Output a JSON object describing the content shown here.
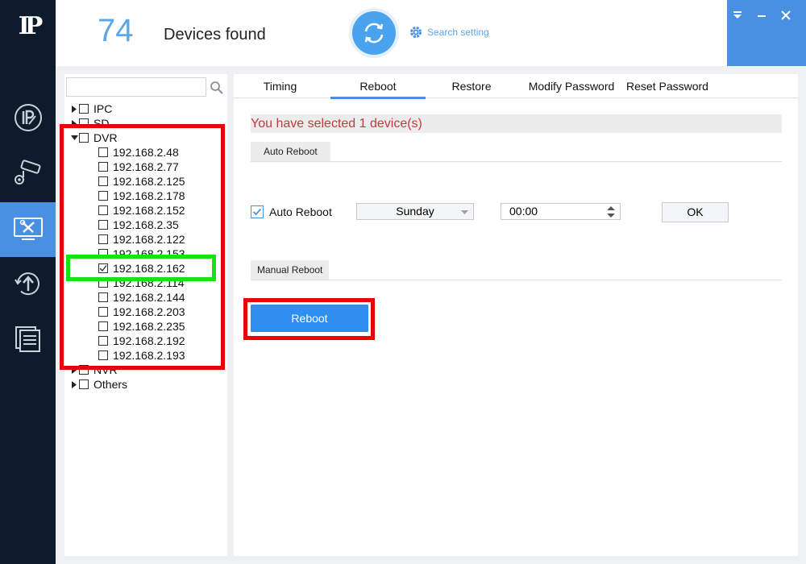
{
  "header": {
    "device_count": "74",
    "devices_found_label": "Devices found",
    "search_setting_label": "Search setting"
  },
  "sidebar": {
    "logo_text": "IP",
    "items": [
      {
        "icon": "ip-icon"
      },
      {
        "icon": "camera-settings-icon"
      },
      {
        "icon": "tools-icon",
        "active": true
      },
      {
        "icon": "upgrade-icon"
      },
      {
        "icon": "document-icon"
      }
    ]
  },
  "tree": {
    "search_value": "",
    "groups_top": [
      {
        "label": "IPC",
        "checked": false
      },
      {
        "label": "SD",
        "checked": false
      },
      {
        "label": "DVR",
        "checked": false
      }
    ],
    "dvr_items": [
      {
        "label": "192.168.2.48",
        "checked": false
      },
      {
        "label": "192.168.2.77",
        "checked": false
      },
      {
        "label": "192.168.2.125",
        "checked": false
      },
      {
        "label": "192.168.2.178",
        "checked": false
      },
      {
        "label": "192.168.2.152",
        "checked": false
      },
      {
        "label": "192.168.2.35",
        "checked": false
      },
      {
        "label": "192.168.2.122",
        "checked": false
      },
      {
        "label": "192.168.2.153",
        "checked": false
      },
      {
        "label": "192.168.2.162",
        "checked": true
      },
      {
        "label": "192.168.2.114",
        "checked": false
      },
      {
        "label": "192.168.2.144",
        "checked": false
      },
      {
        "label": "192.168.2.203",
        "checked": false
      },
      {
        "label": "192.168.2.235",
        "checked": false
      },
      {
        "label": "192.168.2.192",
        "checked": false
      },
      {
        "label": "192.168.2.193",
        "checked": false
      }
    ],
    "groups_bottom": [
      {
        "label": "NVR",
        "checked": false
      },
      {
        "label": "Others",
        "checked": false
      }
    ]
  },
  "tabs": [
    {
      "label": "Timing",
      "active": false
    },
    {
      "label": "Reboot",
      "active": true
    },
    {
      "label": "Restore",
      "active": false
    },
    {
      "label": "Modify Password",
      "active": false
    },
    {
      "label": "Reset Password",
      "active": false
    }
  ],
  "reboot": {
    "selected_message": "You have selected 1 device(s)",
    "auto_section_title": "Auto Reboot",
    "auto_reboot_label": "Auto Reboot",
    "auto_reboot_checked": true,
    "day_value": "Sunday",
    "time_value": "00:00",
    "ok_label": "OK",
    "manual_section_title": "Manual Reboot",
    "reboot_button_label": "Reboot"
  },
  "colors": {
    "accent": "#4a90e2",
    "sidebar_bg": "#0d1b2b",
    "annotation_red": "#ea0000",
    "annotation_green": "#16e316",
    "message_red": "#c8383c"
  }
}
